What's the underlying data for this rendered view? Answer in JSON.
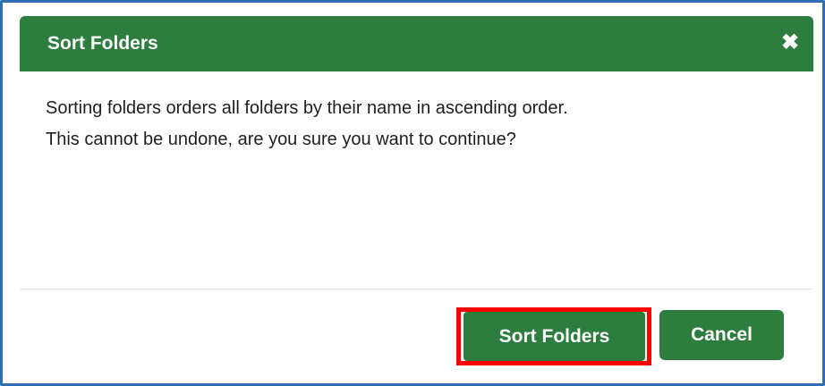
{
  "dialog": {
    "title": "Sort Folders",
    "close_symbol": "✖",
    "close_icon": "close-icon",
    "message_lines": [
      "Sorting folders orders all folders by their name in ascending order.",
      "This cannot be undone, are you sure you want to continue?"
    ]
  },
  "buttons": {
    "sort_label": "Sort Folders",
    "cancel_label": "Cancel"
  },
  "colors": {
    "header_green": "#2d7d3f",
    "button_green": "#2d7d3f",
    "highlight_red": "#ff0000",
    "frame_blue": "#2f6db4"
  }
}
